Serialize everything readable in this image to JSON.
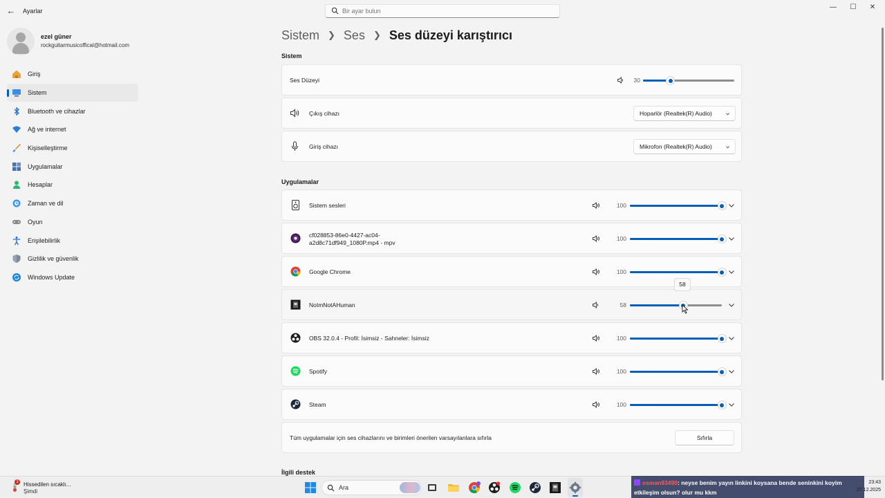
{
  "window": {
    "app_title": "Ayarlar",
    "search_placeholder": "Bir ayar bulun",
    "minimize": "—",
    "maximize": "☐",
    "close": "✕"
  },
  "profile": {
    "name": "ezel güner",
    "email": "rockguitarmusicoffical@hotmail.com"
  },
  "sidebar": {
    "items": [
      {
        "label": "Giriş",
        "icon": "home-icon",
        "active": false
      },
      {
        "label": "Sistem",
        "icon": "system-monitor-icon",
        "active": true
      },
      {
        "label": "Bluetooth ve cihazlar",
        "icon": "bluetooth-icon",
        "active": false
      },
      {
        "label": "Ağ ve internet",
        "icon": "wifi-icon",
        "active": false
      },
      {
        "label": "Kişiselleştirme",
        "icon": "brush-icon",
        "active": false
      },
      {
        "label": "Uygulamalar",
        "icon": "apps-icon",
        "active": false
      },
      {
        "label": "Hesaplar",
        "icon": "account-icon",
        "active": false
      },
      {
        "label": "Zaman ve dil",
        "icon": "globe-clock-icon",
        "active": false
      },
      {
        "label": "Oyun",
        "icon": "gamepad-icon",
        "active": false
      },
      {
        "label": "Erişilebilirlik",
        "icon": "accessibility-icon",
        "active": false
      },
      {
        "label": "Gizlilik ve güvenlik",
        "icon": "shield-icon",
        "active": false
      },
      {
        "label": "Windows Update",
        "icon": "update-icon",
        "active": false
      }
    ]
  },
  "breadcrumb": {
    "items": [
      "Sistem",
      "Ses"
    ],
    "current": "Ses düzeyi karıştırıcı"
  },
  "system_section": {
    "title": "Sistem",
    "volume_label": "Ses Düzeyi",
    "volume_value": "30",
    "volume_level": 30,
    "output_label": "Çıkış cihazı",
    "output_device": "Hoparlör (Realtek(R) Audio)",
    "input_label": "Giriş cihazı",
    "input_device": "Mikrofon (Realtek(R) Audio)"
  },
  "apps_section": {
    "title": "Uygulamalar",
    "apps": [
      {
        "name": "Sistem sesleri",
        "value": "100",
        "level": 100,
        "icon": "system-sounds-icon"
      },
      {
        "name": "cf028853-86e0-4427-ac04-",
        "name2": "a2d8c71df949_1080P.mp4 - mpv",
        "value": "100",
        "level": 100,
        "icon": "mpv-icon"
      },
      {
        "name": "Google Chrome",
        "value": "100",
        "level": 100,
        "icon": "chrome-icon"
      },
      {
        "name": "NoImNotAHuman",
        "value": "58",
        "level": 58,
        "icon": "game-icon"
      },
      {
        "name": "OBS 32.0.4 - Profil: İsimsiz - Sahneler: İsimsiz",
        "value": "100",
        "level": 100,
        "icon": "obs-icon"
      },
      {
        "name": "Spotify",
        "value": "100",
        "level": 100,
        "icon": "spotify-icon"
      },
      {
        "name": "Steam",
        "value": "100",
        "level": 100,
        "icon": "steam-icon"
      }
    ],
    "tooltip": "58",
    "reset_text": "Tüm uygulamalar için ses cihazlarını ve birimleri önerilen varsayılanlara sıfırla",
    "reset_button": "Sıfırla"
  },
  "related_section": {
    "title": "İlgili destek"
  },
  "taskbar": {
    "weather_line1": "Hissedilen sıcaklı...",
    "weather_line2": "Şimdi",
    "weather_badge": "3",
    "search_label": "Ara",
    "time": "23:43",
    "date": "27.12.2025"
  },
  "chat": {
    "user": "osman93490",
    "message": ": neyse benim yayın linkini koysana bende seninkini koyim etkileşim olsun? olur mu kkm"
  },
  "colors": {
    "accent": "#005fb8",
    "background": "#f3f3f3",
    "card": "#fbfbfb"
  }
}
